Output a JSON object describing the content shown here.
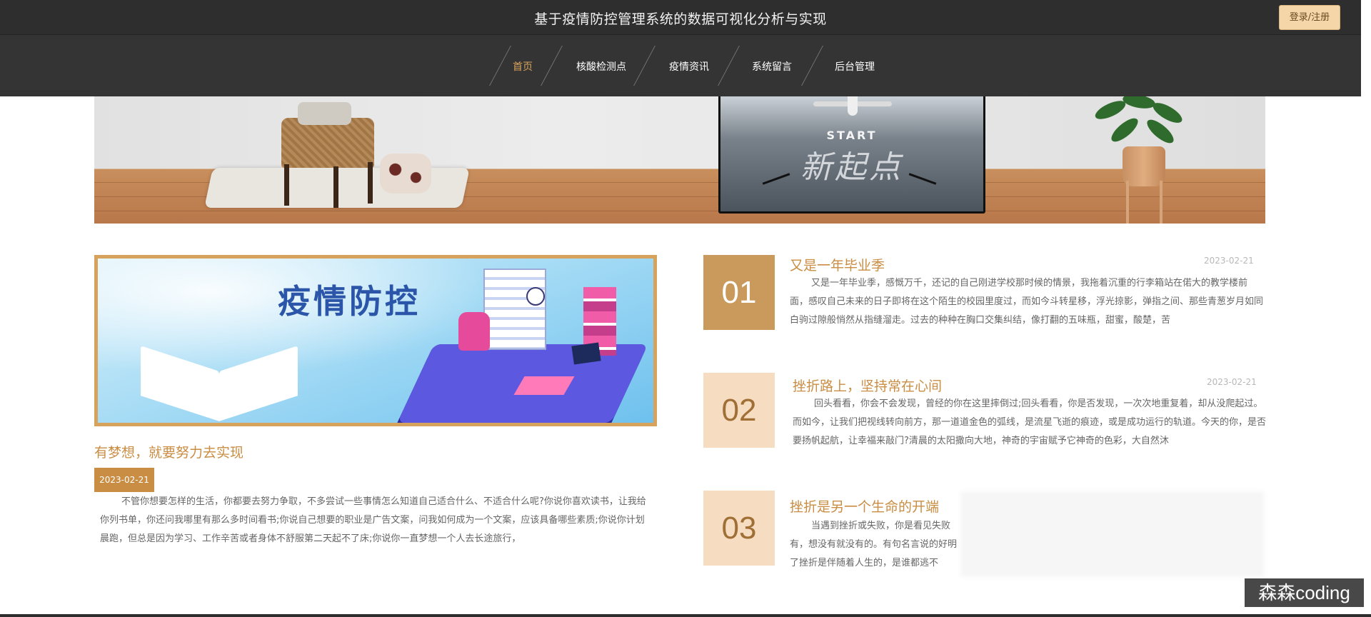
{
  "header": {
    "site_title": "基于疫情防控管理系统的数据可视化分析与实现",
    "login_label": "登录/注册"
  },
  "nav": {
    "items": [
      {
        "label": "首页",
        "active": true
      },
      {
        "label": "核酸检测点",
        "active": false
      },
      {
        "label": "疫情资讯",
        "active": false
      },
      {
        "label": "系统留言",
        "active": false
      },
      {
        "label": "后台管理",
        "active": false
      }
    ]
  },
  "banner": {
    "tv_start": "START",
    "tv_slogan": "新起点"
  },
  "feature": {
    "image_text": "疫情防控",
    "heading": "有梦想，就要努力去实现",
    "date": "2023-02-21",
    "text": "不管你想要怎样的生活，你都要去努力争取，不多尝试一些事情怎么知道自己适合什么、不适合什么呢?你说你喜欢读书，让我给你列书单，你还问我哪里有那么多时间看书;你说自己想要的职业是广告文案，问我如何成为一个文案，应该具备哪些素质;你说你计划晨跑，但总是因为学习、工作辛苦或者身体不舒服第二天起不了床;你说你一直梦想一个人去长途旅行，"
  },
  "news": [
    {
      "num": "01",
      "title": "又是一年毕业季",
      "date": "2023-02-21",
      "text": "又是一年毕业季，感慨万千，还记的自己刚进学校那时候的情景，我拖着沉重的行李箱站在偌大的教学楼前面，感叹自己未来的日子即将在这个陌生的校园里度过，而如今斗转星移，浮光掠影，弹指之间、那些青葱岁月如同白驹过隙般悄然从指缝溜走。过去的种种在胸口交集纠结，像打翻的五味瓶，甜蜜，酸楚，苦"
    },
    {
      "num": "02",
      "title": "挫折路上，坚持常在心间",
      "date": "2023-02-21",
      "text": "回头看看，你会不会发现，曾经的你在这里摔倒过;回头看看，你是否发现，一次次地重复着，却从没爬起过。而如今，让我们把视线转向前方，那一道道金色的弧线，是流星飞逝的痕迹，或是成功运行的轨道。今天的你，是否要扬帆起航，让幸福来敲门?清晨的太阳撒向大地，神奇的宇宙赋予它神奇的色彩，大自然沐"
    },
    {
      "num": "03",
      "title": "挫折是另一个生命的开端",
      "date": "",
      "text": "当遇到挫折或失败，你是看见失败有，想没有就没有的。有句名言说的好明了挫折是伴随着人生的，是谁都逃不"
    }
  ],
  "watermark": "森森coding",
  "colors": {
    "accent": "#c98d43",
    "topbar": "#2e2e2e",
    "badge_light": "#f6dcc0",
    "badge_dark": "#c99a5c"
  }
}
